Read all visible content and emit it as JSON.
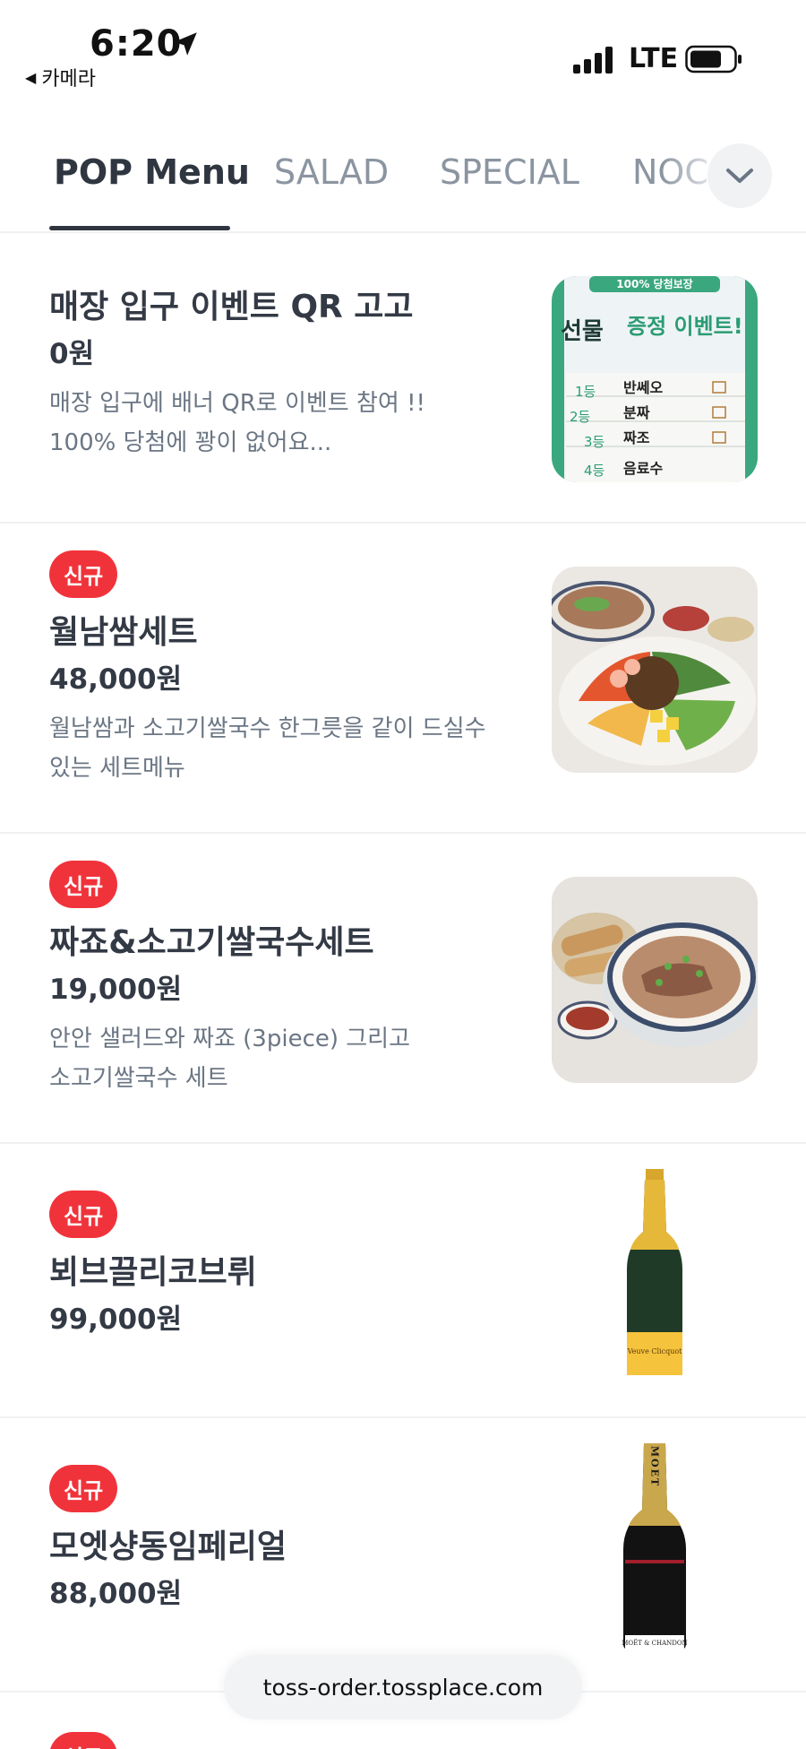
{
  "status_bar": {
    "time": "6:20",
    "back_app": "카메라",
    "network": "LTE"
  },
  "tabs": [
    {
      "label": "POP Menu",
      "active": true
    },
    {
      "label": "SALAD",
      "active": false
    },
    {
      "label": "SPECIAL",
      "active": false
    },
    {
      "label": "NOC",
      "active": false
    }
  ],
  "items": [
    {
      "name": "매장 입구 이벤트 QR 고고",
      "price": "0원",
      "desc": "매장 입구에 배너 QR로 이벤트 참여 !!\n100% 당첨에 꽝이 없어요...",
      "image": "event-poster",
      "poster": {
        "top": "100% 당첨보장",
        "title_a": "선물",
        "title_b": "증정 이벤트!",
        "rows": [
          {
            "rank": "1등",
            "prize": "반쎄오"
          },
          {
            "rank": "2등",
            "prize": "분짜"
          },
          {
            "rank": "3등",
            "prize": "짜조"
          },
          {
            "rank": "4등",
            "prize": "음료수"
          }
        ]
      }
    },
    {
      "badge": "신규",
      "name": "월남쌈세트",
      "price": "48,000원",
      "desc": "월남쌈과 소고기쌀국수 한그릇을 같이 드실수\n있는 세트메뉴",
      "image": "spring-roll-platter"
    },
    {
      "badge": "신규",
      "name": "짜죠&소고기쌀국수세트",
      "price": "19,000원",
      "desc": "안안 샐러드와 짜죠 (3piece) 그리고\n소고기쌀국수 세트",
      "image": "pho-set"
    },
    {
      "badge": "신규",
      "name": "뵈브끌리코브뤼",
      "price": "99,000원",
      "image": "champagne-yellow-label",
      "bottle_label": "Veuve Clicquot"
    },
    {
      "badge": "신규",
      "name": "모엣샹동임페리얼",
      "price": "88,000원",
      "image": "champagne-black-label",
      "bottle_label": "MOËT & CHANDON",
      "bottle_neck": "MOET"
    },
    {
      "badge": "신규"
    }
  ],
  "url_bar": {
    "text": "toss-order.tossplace.com"
  },
  "colors": {
    "badge": "#f0333b",
    "active_tab": "#2f3640",
    "inactive_tab": "#8b95a1",
    "poster_green": "#3aa77f"
  }
}
